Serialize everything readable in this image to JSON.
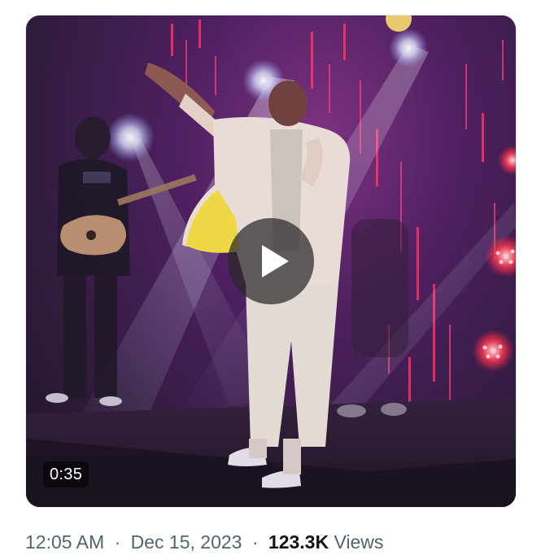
{
  "tweet": {
    "video": {
      "duration": "0:35",
      "play_icon": "play-icon"
    },
    "timestamp": {
      "time": "12:05 AM",
      "separator": "·",
      "date": "Dec 15, 2023"
    },
    "views": {
      "separator": "·",
      "count": "123.3K",
      "label": "Views"
    }
  }
}
